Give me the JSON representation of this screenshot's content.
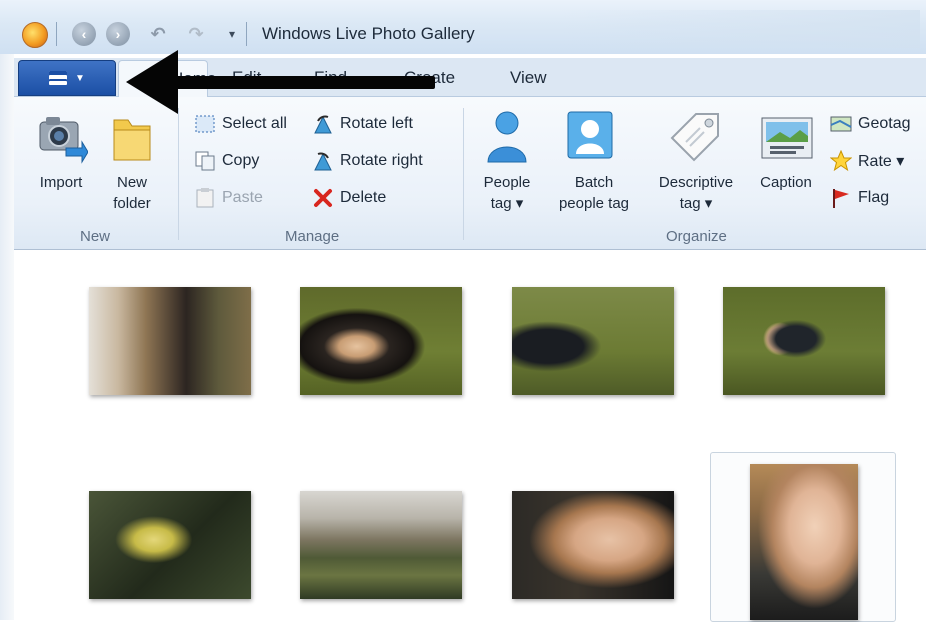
{
  "window": {
    "title": "Windows Live Photo Gallery"
  },
  "quick_access": {
    "icons": [
      "app-icon",
      "back-icon",
      "forward-icon",
      "undo-icon",
      "redo-icon",
      "customize-dropdown-icon"
    ]
  },
  "tabs": [
    {
      "label": "Home"
    },
    {
      "label": "Edit"
    },
    {
      "label": "Find"
    },
    {
      "label": "Create"
    },
    {
      "label": "View"
    }
  ],
  "ribbon": {
    "new": {
      "label": "New",
      "import": "Import",
      "new_folder_line1": "New",
      "new_folder_line2": "folder"
    },
    "manage": {
      "label": "Manage",
      "select_all": "Select all",
      "copy": "Copy",
      "paste": "Paste",
      "rotate_left": "Rotate left",
      "rotate_right": "Rotate right",
      "delete": "Delete"
    },
    "organize": {
      "label": "Organize",
      "people_tag_line1": "People",
      "people_tag_line2": "tag ▾",
      "batch_line1": "Batch",
      "batch_line2": "people tag",
      "descriptive_line1": "Descriptive",
      "descriptive_line2": "tag ▾",
      "caption": "Caption",
      "geotag": "Geotag",
      "rate": "Rate ▾",
      "flag": "Flag"
    }
  },
  "annotation": {
    "type": "arrow",
    "points_to": "app-menu-button",
    "color": "#050505"
  },
  "photos": [
    {
      "subject": "toddler lying sideways on grass"
    },
    {
      "subject": "toddler from behind with pigeons"
    },
    {
      "subject": "toddler chasing pigeons"
    },
    {
      "subject": "toddler lying on grass"
    },
    {
      "subject": "yellow leaves close-up"
    },
    {
      "subject": "park with trees and pond"
    },
    {
      "subject": "toddler face close-up"
    },
    {
      "subject": "toddler portrait",
      "selected": true
    }
  ],
  "colors": {
    "app_menu": "#1b4fa5",
    "ribbon_bg": "#eaf1f9",
    "title_text": "#1d2a3a",
    "group_label": "#5e6f84"
  }
}
